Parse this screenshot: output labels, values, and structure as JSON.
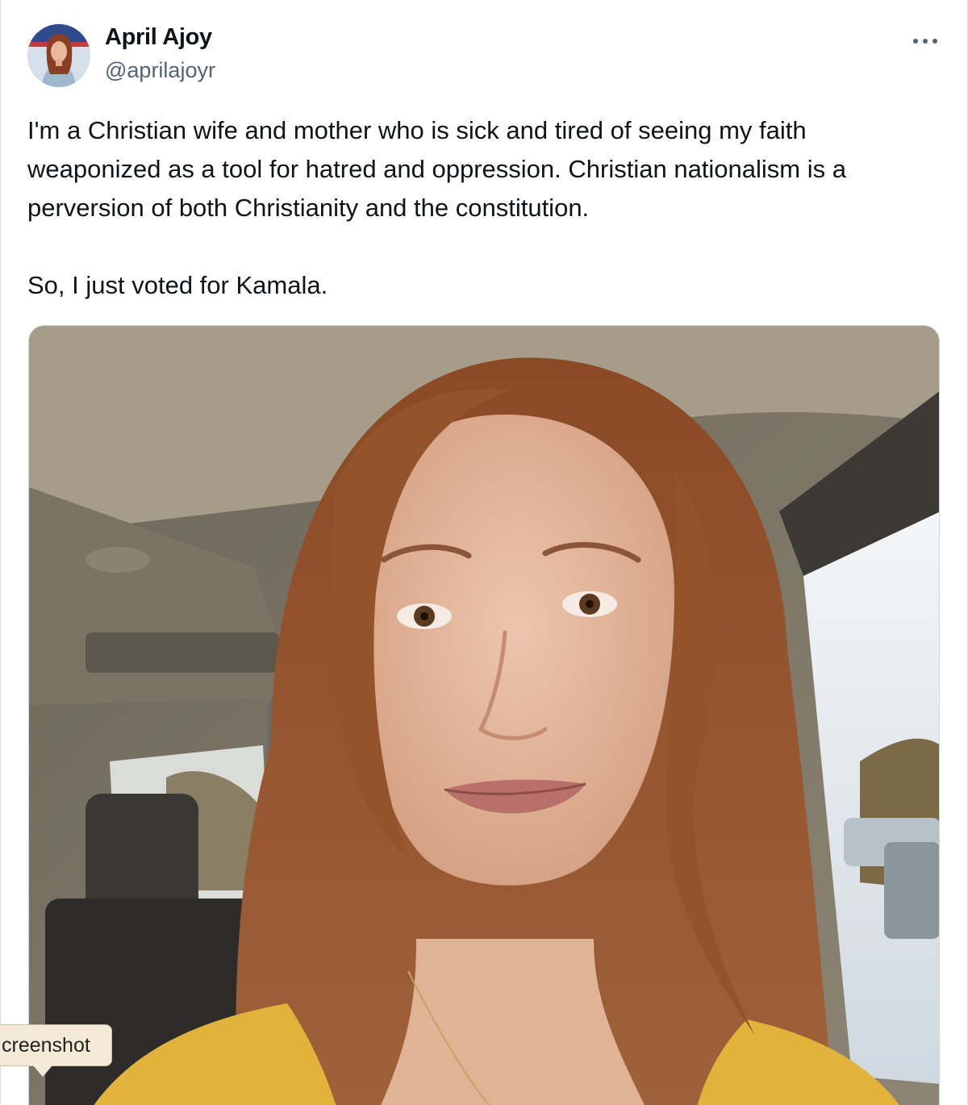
{
  "author": {
    "display_name": "April Ajoy",
    "handle": "@aprilajoyr",
    "avatar": "avatar-photo"
  },
  "more_menu": {
    "icon": "more-horizontal-icon"
  },
  "tweet": {
    "paragraph_1": "I'm a Christian wife and mother who is sick and tired of seeing my faith weaponized as a tool for hatred and oppression. Christian nationalism is a perversion of both Christianity and the constitution.",
    "paragraph_2": "So, I just voted for Kamala."
  },
  "media": {
    "kind": "photo"
  },
  "overlay_tag": {
    "label": "creenshot"
  },
  "colors": {
    "text_primary": "#0f1419",
    "text_secondary": "#536471",
    "border": "#cfd9de",
    "tag_background": "#f3ead8"
  }
}
